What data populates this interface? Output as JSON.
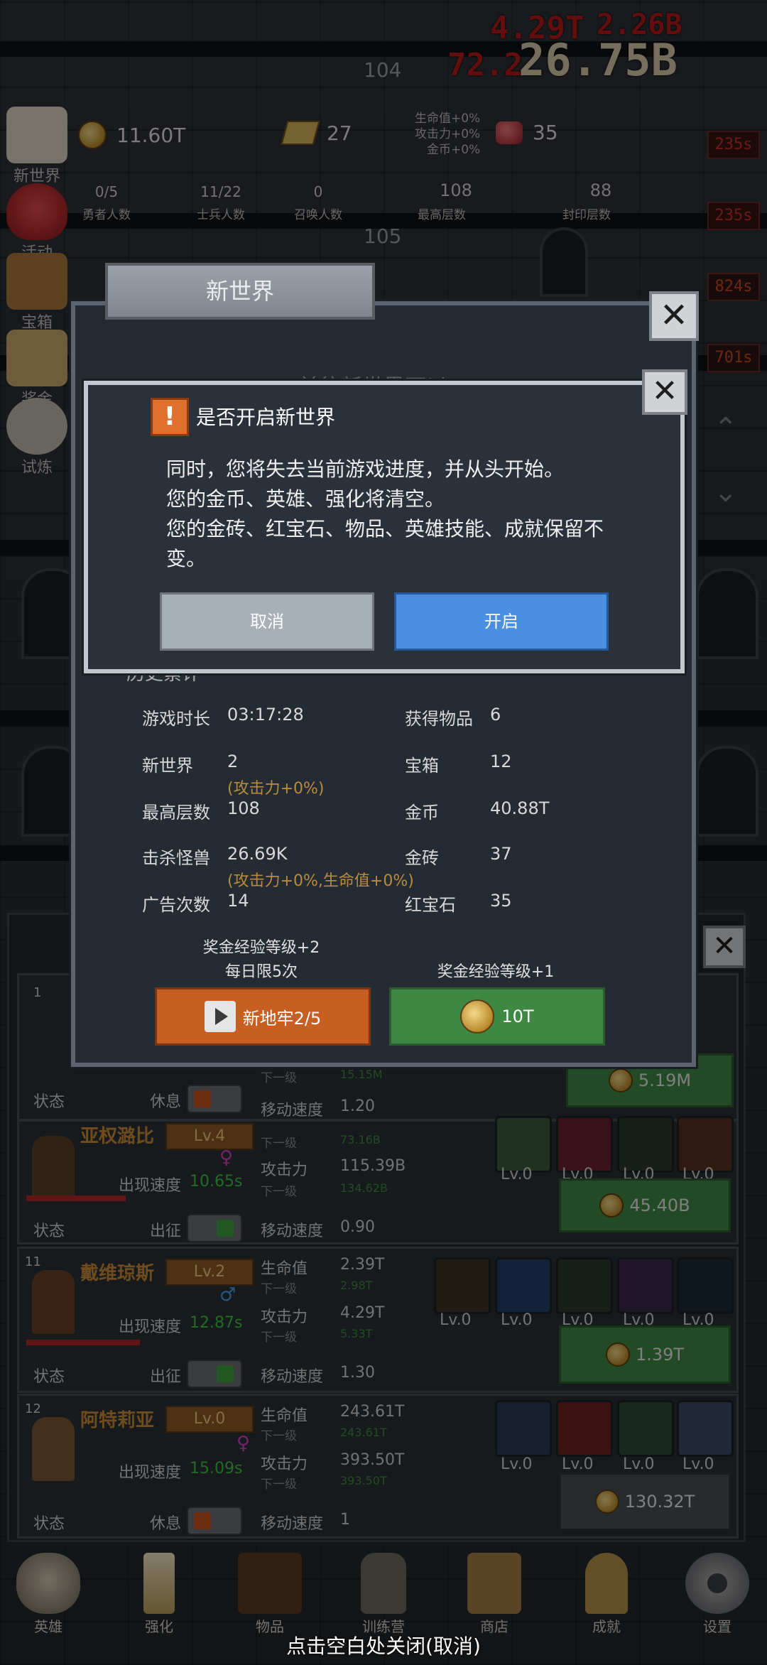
{
  "floors": {
    "upper": "104",
    "lower": "105"
  },
  "damage_numbers": [
    "4.29T",
    "2.26B",
    "72.2",
    "26.75B"
  ],
  "side_menu": [
    {
      "label": "新世界"
    },
    {
      "label": "活动"
    },
    {
      "label": "宝箱"
    },
    {
      "label": "奖金"
    },
    {
      "label": "试炼"
    }
  ],
  "resources": {
    "gold": "11.60T",
    "gold_bars": "27",
    "bonus_lines": [
      "生命值+0%",
      "攻击力+0%",
      "金币+0%"
    ],
    "rubies": "35"
  },
  "counters": [
    {
      "value": "0/5",
      "label": "勇者人数"
    },
    {
      "value": "11/22",
      "label": "士兵人数"
    },
    {
      "value": "0",
      "label": "召唤人数"
    },
    {
      "value": "108",
      "label": "最高层数"
    },
    {
      "value": "88",
      "label": "封印层数"
    }
  ],
  "right_timers": [
    "235s",
    "235s",
    "824s",
    "701s"
  ],
  "new_world_panel": {
    "title": "新世界",
    "stats_header": "历史累计",
    "stats": [
      {
        "label": "游戏时长",
        "value": "03:17:28",
        "label2": "获得物品",
        "value2": "6"
      },
      {
        "label": "新世界",
        "value": "2",
        "bonus": "(攻击力+0%)",
        "label2": "宝箱",
        "value2": "12"
      },
      {
        "label": "最高层数",
        "value": "108",
        "label2": "金币",
        "value2": "40.88T"
      },
      {
        "label": "击杀怪兽",
        "value": "26.69K",
        "bonus": "(攻击力+0%,生命值+0%)",
        "label2": "金砖",
        "value2": "37"
      },
      {
        "label": "广告次数",
        "value": "14",
        "label2": "红宝石",
        "value2": "35"
      }
    ],
    "left_option_line1": "奖金经验等级+2",
    "left_option_line2": "每日限5次",
    "left_button": "新地牢2/5",
    "right_option": "奖金经验等级+1",
    "right_button": "10T"
  },
  "confirm_dialog": {
    "title": "是否开启新世界",
    "body": [
      "同时，您将失去当前游戏进度，并从头开始。",
      "您的金币、英雄、强化将清空。",
      "您的金砖、红宝石、物品、英雄技能、成就保留不",
      "变。"
    ],
    "cancel": "取消",
    "confirm": "开启"
  },
  "heroes_top": {
    "index": "1",
    "state_label": "状态",
    "state_value": "休息",
    "next_level": "下一级",
    "next_value": "15.15M",
    "move_label": "移动速度",
    "move_value": "1.20",
    "upgrade_cost": "5.19M"
  },
  "heroes": [
    {
      "name": "亚权潞比",
      "level": "Lv.4",
      "appear_label": "出现速度",
      "appear_value": "10.65s",
      "state_label": "状态",
      "state_value": "出征",
      "next_label": "下一级",
      "next_hp": "73.16B",
      "atk_label": "攻击力",
      "atk_value": "115.39B",
      "next_atk": "134.62B",
      "move_label": "移动速度",
      "move_value": "0.90",
      "skills": [
        "Lv.0",
        "Lv.0",
        "Lv.0",
        "Lv.0"
      ],
      "cost": "45.40B"
    },
    {
      "index": "11",
      "name": "戴维琼斯",
      "level": "Lv.2",
      "appear_label": "出现速度",
      "appear_value": "12.87s",
      "state_label": "状态",
      "state_value": "出征",
      "hp_label": "生命值",
      "hp_value": "2.39T",
      "next_label": "下一级",
      "next_hp": "2.98T",
      "atk_label": "攻击力",
      "atk_value": "4.29T",
      "next_atk": "5.33T",
      "move_label": "移动速度",
      "move_value": "1.30",
      "skills": [
        "Lv.0",
        "Lv.0",
        "Lv.0",
        "Lv.0",
        "Lv.0"
      ],
      "cost": "1.39T"
    },
    {
      "index": "12",
      "name": "阿特莉亚",
      "level": "Lv.0",
      "appear_label": "出现速度",
      "appear_value": "15.09s",
      "state_label": "状态",
      "state_value": "休息",
      "hp_label": "生命值",
      "hp_value": "243.61T",
      "next_label": "下一级",
      "next_hp": "243.61T",
      "atk_label": "攻击力",
      "atk_value": "393.50T",
      "next_atk": "393.50T",
      "move_label": "移动速度",
      "move_value": "1",
      "skills": [
        "Lv.0",
        "Lv.0",
        "Lv.0",
        "Lv.0"
      ],
      "cost": "130.32T"
    }
  ],
  "bottom_nav": [
    {
      "label": "英雄",
      "icon": "skull-icon"
    },
    {
      "label": "强化",
      "icon": "candle-icon"
    },
    {
      "label": "物品",
      "icon": "book-icon"
    },
    {
      "label": "训练营",
      "icon": "lantern-icon"
    },
    {
      "label": "商店",
      "icon": "mug-icon"
    },
    {
      "label": "成就",
      "icon": "key-icon"
    },
    {
      "label": "设置",
      "icon": "gear-icon"
    }
  ],
  "close_hint": "点击空白处关闭(取消)",
  "colors": {
    "accent_blue": "#4a8fe0",
    "accent_orange": "#c85f22",
    "green_button": "#3f8844",
    "damage_red": "#b21a1a"
  }
}
